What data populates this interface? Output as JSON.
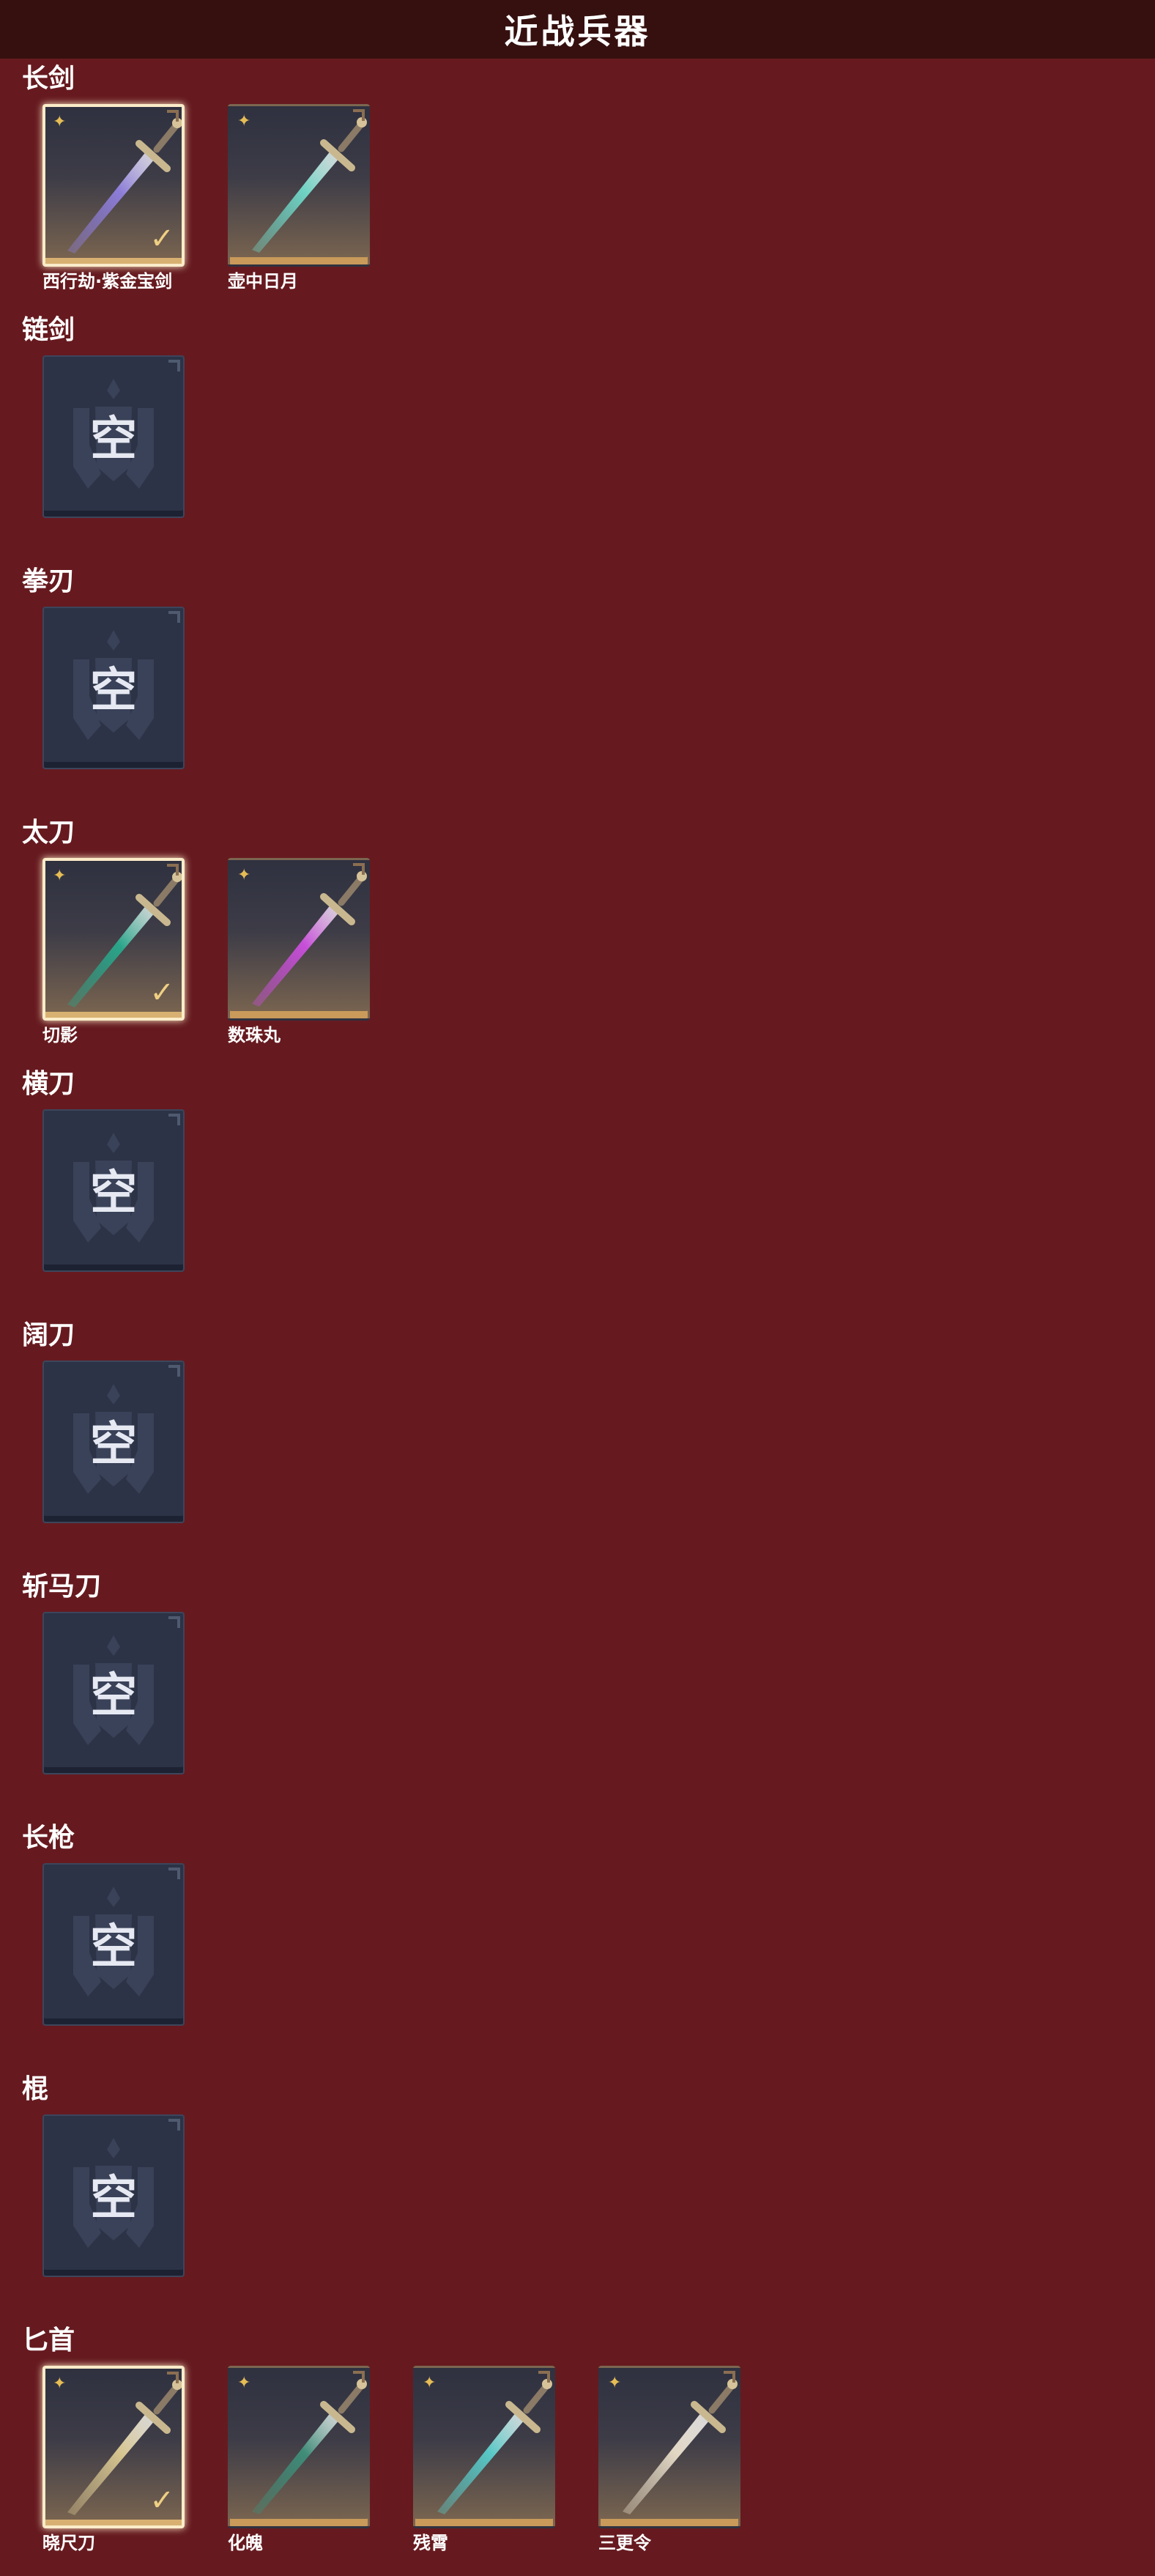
{
  "header": {
    "title": "近战兵器"
  },
  "empty_label": "空",
  "icons": {
    "rarity": "four-point-star-icon",
    "equipped": "checkmark-icon",
    "empty": "shield-emblem-icon",
    "corner": "corner-bracket-icon"
  },
  "colors": {
    "background": "#661a1f",
    "header": "#35100f",
    "empty_card": "#2c3346",
    "equipped_border": "#fbecc9",
    "star": "#e6bd55",
    "check": "#efcf83"
  },
  "categories": [
    {
      "label": "长剑",
      "items": [
        {
          "name": "西行劫·紫金宝剑",
          "equipped": true,
          "blade": "#8d7dd8"
        },
        {
          "name": "壶中日月",
          "equipped": false,
          "blade": "#6fd3c4"
        }
      ]
    },
    {
      "label": "链剑",
      "items": []
    },
    {
      "label": "拳刃",
      "items": []
    },
    {
      "label": "太刀",
      "items": [
        {
          "name": "切影",
          "equipped": true,
          "blade": "#2aa58a"
        },
        {
          "name": "数珠丸",
          "equipped": false,
          "blade": "#c74fd8"
        }
      ]
    },
    {
      "label": "横刀",
      "items": []
    },
    {
      "label": "阔刀",
      "items": []
    },
    {
      "label": "斩马刀",
      "items": []
    },
    {
      "label": "长枪",
      "items": []
    },
    {
      "label": "棍",
      "items": []
    },
    {
      "label": "匕首",
      "items": [
        {
          "name": "晓尺刀",
          "equipped": true,
          "blade": "#d6c48f"
        },
        {
          "name": "化魄",
          "equipped": false,
          "blade": "#3f8c78"
        },
        {
          "name": "残霄",
          "equipped": false,
          "blade": "#58c8c6"
        },
        {
          "name": "三更令",
          "equipped": false,
          "blade": "#e2d7c3"
        }
      ]
    }
  ]
}
